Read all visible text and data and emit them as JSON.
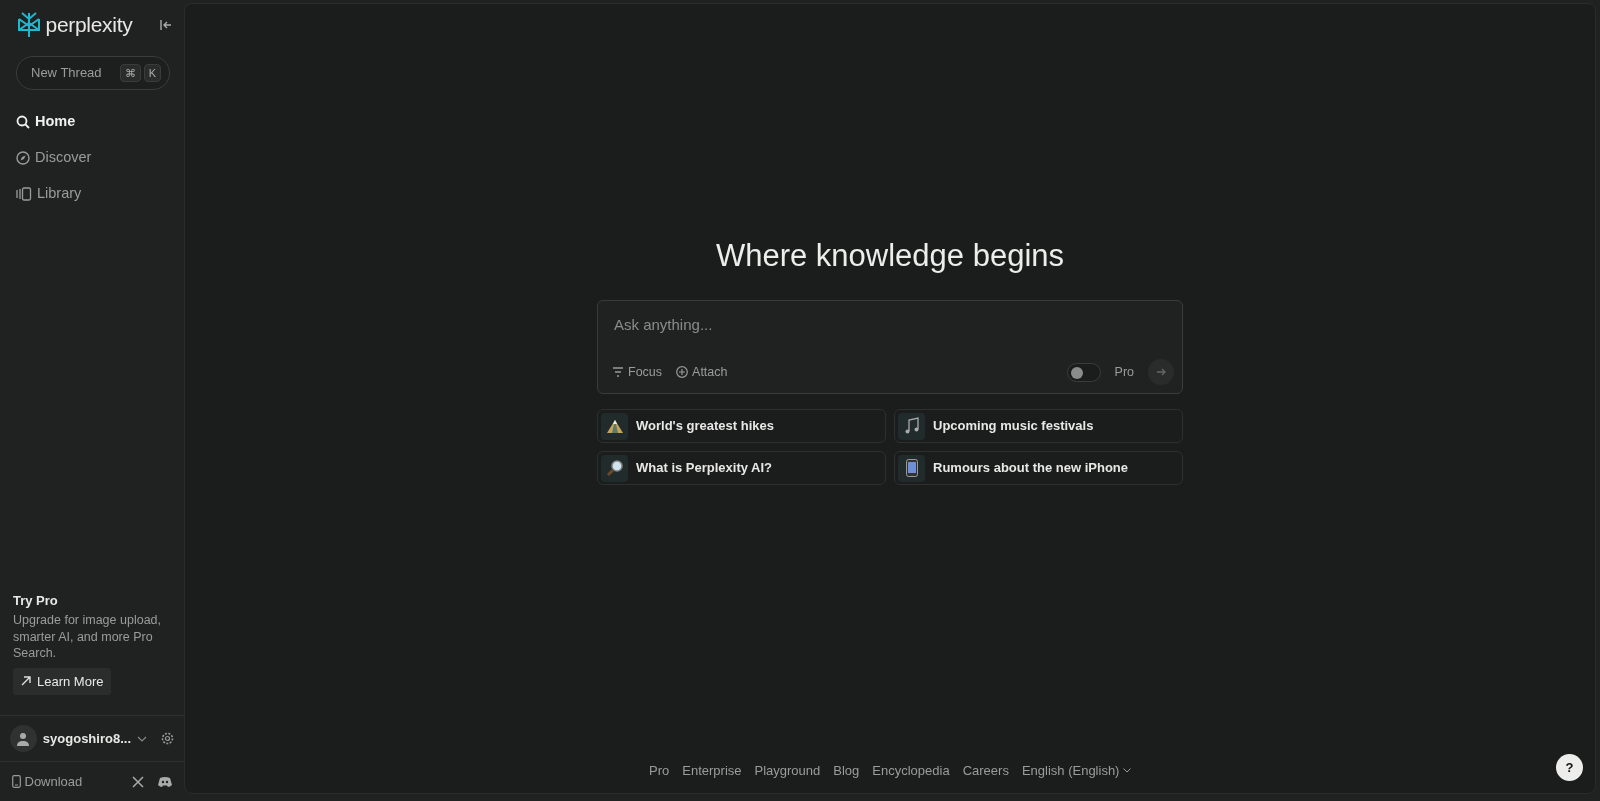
{
  "sidebar": {
    "logo": "perplexity",
    "new_thread": {
      "label": "New Thread",
      "keys": [
        "⌘",
        "K"
      ]
    },
    "nav": [
      {
        "label": "Home",
        "selected": true
      },
      {
        "label": "Discover",
        "selected": false
      },
      {
        "label": "Library",
        "selected": false
      }
    ],
    "promo": {
      "title": "Try Pro",
      "text": "Upgrade for image upload, smarter AI, and more Pro Search.",
      "button": "Learn More"
    },
    "user": {
      "name": "syogoshiro8..."
    },
    "download": "Download"
  },
  "main": {
    "heading": "Where knowledge begins",
    "search": {
      "placeholder": "Ask anything...",
      "focus": "Focus",
      "attach": "Attach",
      "pro_toggle": {
        "label": "Pro",
        "on": false
      }
    },
    "suggestions": [
      {
        "label": "World's greatest hikes"
      },
      {
        "label": "Upcoming music festivals"
      },
      {
        "label": "What is Perplexity AI?"
      },
      {
        "label": "Rumours about the new iPhone"
      }
    ],
    "footer_links": [
      "Pro",
      "Enterprise",
      "Playground",
      "Blog",
      "Encyclopedia",
      "Careers",
      "English (English)"
    ],
    "help": "?"
  }
}
